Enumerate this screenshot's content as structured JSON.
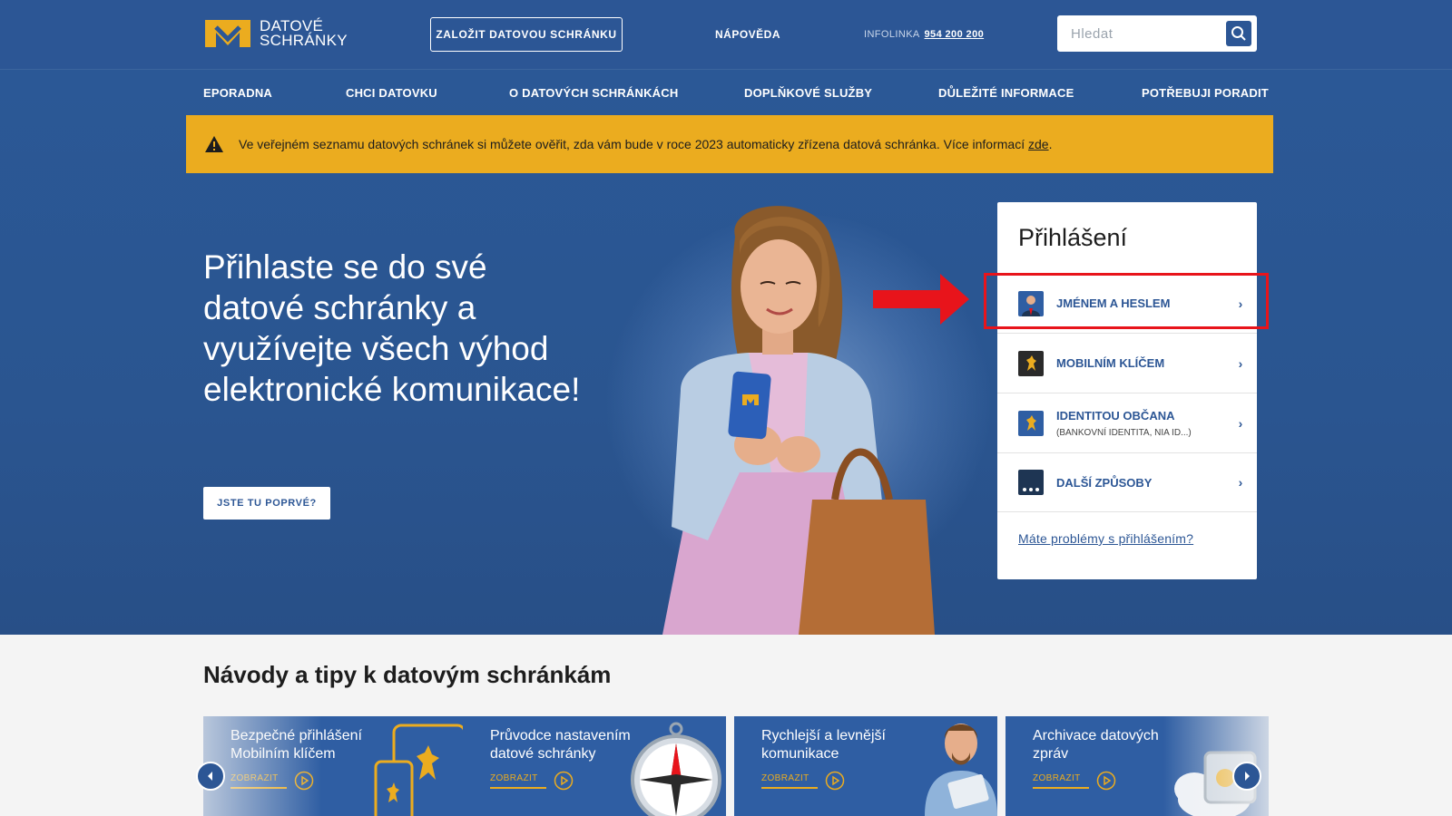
{
  "header": {
    "logo_line1": "DATOVÉ",
    "logo_line2": "SCHRÁNKY",
    "create_button": "ZALOŽIT DATOVOU SCHRÁNKU",
    "help_link": "NÁPOVĚDA",
    "infoline_label": "INFOLINKA",
    "infoline_number": "954 200 200",
    "search_placeholder": "Hledat"
  },
  "nav": {
    "items": [
      {
        "label": "EPORADNA"
      },
      {
        "label": "CHCI DATOVKU"
      },
      {
        "label": "O DATOVÝCH SCHRÁNKÁCH"
      },
      {
        "label": "DOPLŇKOVÉ SLUŽBY"
      },
      {
        "label": "DŮLEŽITÉ INFORMACE"
      },
      {
        "label": "POTŘEBUJI PORADIT"
      }
    ]
  },
  "alert": {
    "text": "Ve veřejném seznamu datových schránek si můžete ověřit, zda vám bude v roce 2023 automaticky zřízena datová schránka. Více informací ",
    "link": "zde",
    "end": "."
  },
  "hero": {
    "headline": "Přihlaste se do své datové schránky a využívejte všech výhod elektronické komunikace!",
    "first_time_button": "JSTE TU POPRVÉ?"
  },
  "login": {
    "title": "Přihlášení",
    "options": [
      {
        "label": "JMÉNEM A HESLEM",
        "sub": "",
        "chevron": "›"
      },
      {
        "label": "MOBILNÍM KLÍČEM",
        "sub": "",
        "chevron": "›"
      },
      {
        "label": "IDENTITOU OBČANA",
        "sub": "(BANKOVNÍ IDENTITA, NIA ID...)",
        "chevron": "›"
      },
      {
        "label": "DALŠÍ ZPŮSOBY",
        "sub": "",
        "chevron": "›"
      }
    ],
    "problem_link": "Máte problémy s přihlášením?"
  },
  "tips": {
    "title": "Návody a tipy k datovým schránkám",
    "cards": [
      {
        "title": "Bezpečné přihlášení Mobilním klíčem",
        "cta": "ZOBRAZIT"
      },
      {
        "title": "Průvodce nastavením datové schránky",
        "cta": "ZOBRAZIT"
      },
      {
        "title": "Rychlejší a levnější komunikace",
        "cta": "ZOBRAZIT"
      },
      {
        "title": "Archivace datových zpráv",
        "cta": "ZOBRAZIT"
      }
    ]
  },
  "colors": {
    "primary": "#2c5695",
    "accent": "#ebac1f",
    "highlight": "#e8141b"
  }
}
